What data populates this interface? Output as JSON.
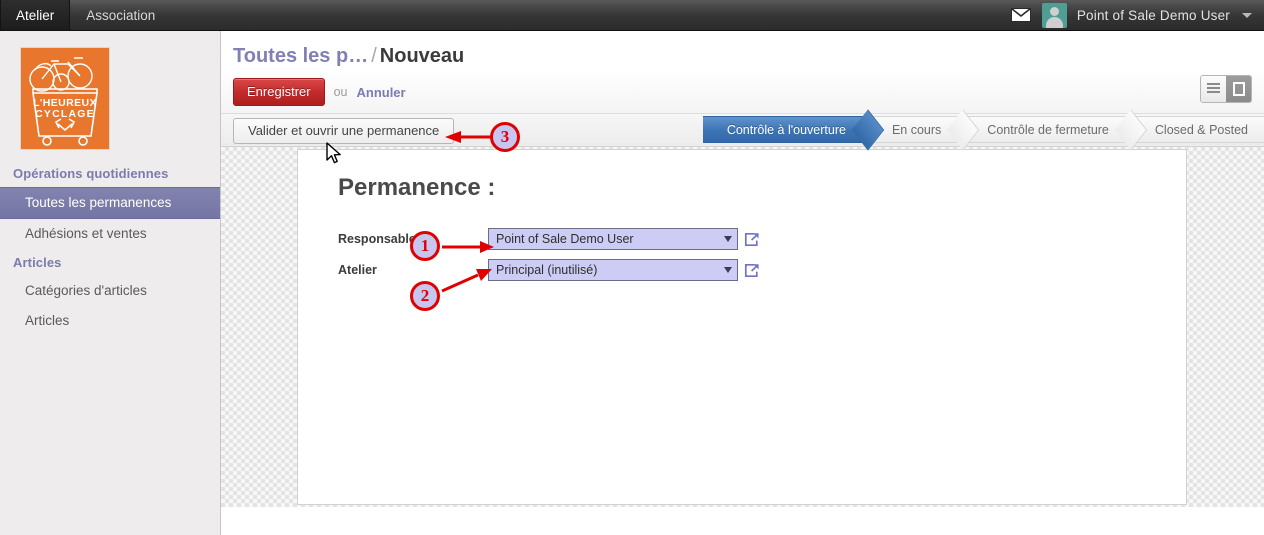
{
  "topbar": {
    "menus": [
      {
        "label": "Atelier",
        "active": true
      },
      {
        "label": "Association",
        "active": false
      }
    ],
    "mail_icon": "envelope-icon",
    "username": "Point of Sale Demo User",
    "avatar_color": "#4f9e93"
  },
  "sidebar": {
    "logo": {
      "name": "lheureux-cyclage-logo",
      "line1": "L'HEUREUX",
      "line2": "CYCLAGE",
      "bg_color": "#e8762c"
    },
    "sections": [
      {
        "title": "Opérations quotidiennes",
        "items": [
          {
            "label": "Toutes les permanences",
            "active": true
          },
          {
            "label": "Adhésions et ventes",
            "active": false
          }
        ]
      },
      {
        "title": "Articles",
        "items": [
          {
            "label": "Catégories d'articles",
            "active": false
          },
          {
            "label": "Articles",
            "active": false
          }
        ]
      }
    ]
  },
  "breadcrumb": {
    "parent": "Toutes les p…",
    "separator": "/",
    "current": "Nouveau"
  },
  "actions": {
    "save_label": "Enregistrer",
    "or_label": "ou",
    "cancel_label": "Annuler",
    "validate_label": "Valider et ouvrir une permanence"
  },
  "view_switch": {
    "list_icon": "list-view-icon",
    "form_icon": "form-view-icon",
    "active": "form"
  },
  "statusbar": {
    "steps": [
      {
        "label": "Contrôle à l'ouverture",
        "active": true
      },
      {
        "label": "En cours",
        "active": false
      },
      {
        "label": "Contrôle de fermeture",
        "active": false
      },
      {
        "label": "Closed & Posted",
        "active": false
      }
    ]
  },
  "form": {
    "title": "Permanence :",
    "fields": [
      {
        "label": "Responsable",
        "value": "Point of Sale Demo User",
        "caret": "▼",
        "ext_icon": "open-record-icon"
      },
      {
        "label": "Atelier",
        "value": "Principal (inutilisé)",
        "caret": "▼",
        "ext_icon": "open-record-icon"
      }
    ]
  },
  "annotations": [
    {
      "number": "1"
    },
    {
      "number": "2"
    },
    {
      "number": "3"
    }
  ],
  "colors": {
    "accent_red": "#e00000",
    "save_red": "#c42b2b",
    "field_lavender": "#ccccf5",
    "sidebar_active": "#7c7cac",
    "status_active_blue": "#3b74b4"
  }
}
